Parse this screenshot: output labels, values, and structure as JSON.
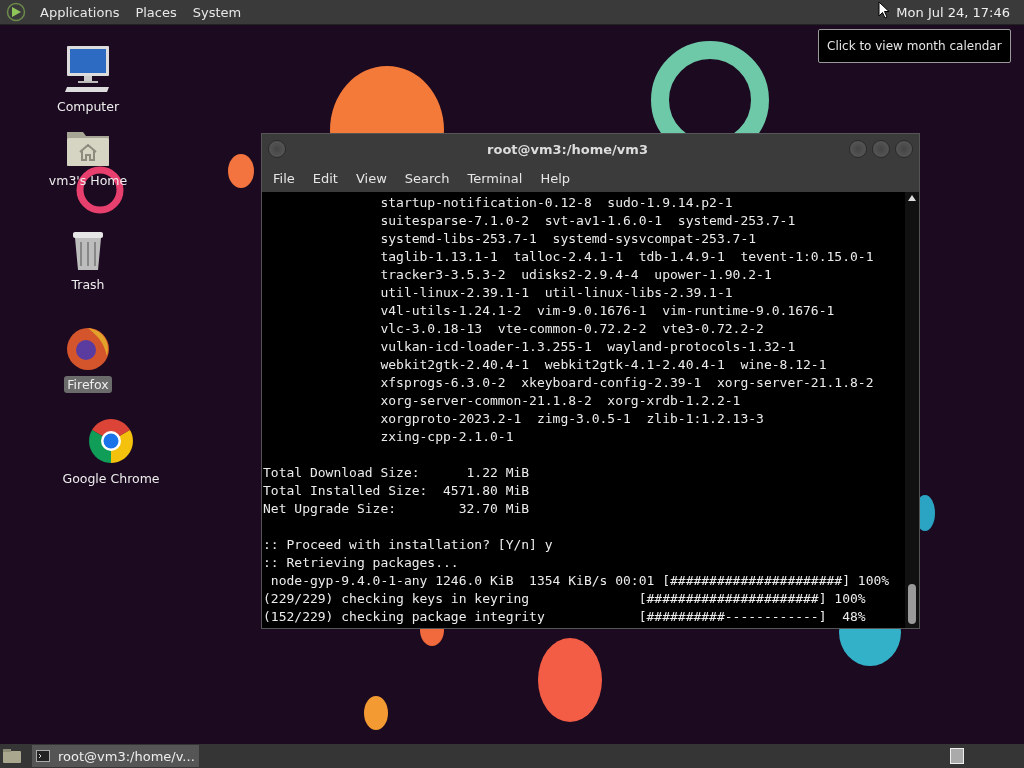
{
  "panel": {
    "menus": [
      "Applications",
      "Places",
      "System"
    ],
    "clock": "Mon Jul 24, 17:46"
  },
  "tooltip": "Click to view month calendar",
  "desktop_icons": [
    {
      "label": "Computer",
      "kind": "computer",
      "selected": false
    },
    {
      "label": "vm3's Home",
      "kind": "home",
      "selected": false
    },
    {
      "label": "Trash",
      "kind": "trash",
      "selected": false
    },
    {
      "label": "Firefox",
      "kind": "firefox",
      "selected": true
    },
    {
      "label": "Google Chrome",
      "kind": "chrome",
      "selected": false
    }
  ],
  "terminal": {
    "title": "root@vm3:/home/vm3",
    "menu": [
      "File",
      "Edit",
      "View",
      "Search",
      "Terminal",
      "Help"
    ],
    "blocks": [
      [
        "               startup-notification-0.12-8  sudo-1.9.14.p2-1",
        "               suitesparse-7.1.0-2  svt-av1-1.6.0-1  systemd-253.7-1",
        "               systemd-libs-253.7-1  systemd-sysvcompat-253.7-1",
        "               taglib-1.13.1-1  talloc-2.4.1-1  tdb-1.4.9-1  tevent-1:0.15.0-1",
        "               tracker3-3.5.3-2  udisks2-2.9.4-4  upower-1.90.2-1",
        "               util-linux-2.39.1-1  util-linux-libs-2.39.1-1",
        "               v4l-utils-1.24.1-2  vim-9.0.1676-1  vim-runtime-9.0.1676-1",
        "               vlc-3.0.18-13  vte-common-0.72.2-2  vte3-0.72.2-2",
        "               vulkan-icd-loader-1.3.255-1  wayland-protocols-1.32-1",
        "               webkit2gtk-2.40.4-1  webkit2gtk-4.1-2.40.4-1  wine-8.12-1",
        "               xfsprogs-6.3.0-2  xkeyboard-config-2.39-1  xorg-server-21.1.8-2",
        "               xorg-server-common-21.1.8-2  xorg-xrdb-1.2.2-1",
        "               xorgproto-2023.2-1  zimg-3.0.5-1  zlib-1:1.2.13-3",
        "               zxing-cpp-2.1.0-1"
      ],
      [
        "Total Download Size:      1.22 MiB",
        "Total Installed Size:  4571.80 MiB",
        "Net Upgrade Size:        32.70 MiB"
      ],
      [
        ":: Proceed with installation? [Y/n] y",
        ":: Retrieving packages...",
        " node-gyp-9.4.0-1-any 1246.0 KiB  1354 KiB/s 00:01 [######################] 100%",
        "(229/229) checking keys in keyring              [######################] 100%",
        "(152/229) checking package integrity            [##########------------]  48%"
      ]
    ]
  },
  "taskbar": {
    "tasks": [
      {
        "label": "root@vm3:/home/v...",
        "selected": false
      }
    ]
  }
}
